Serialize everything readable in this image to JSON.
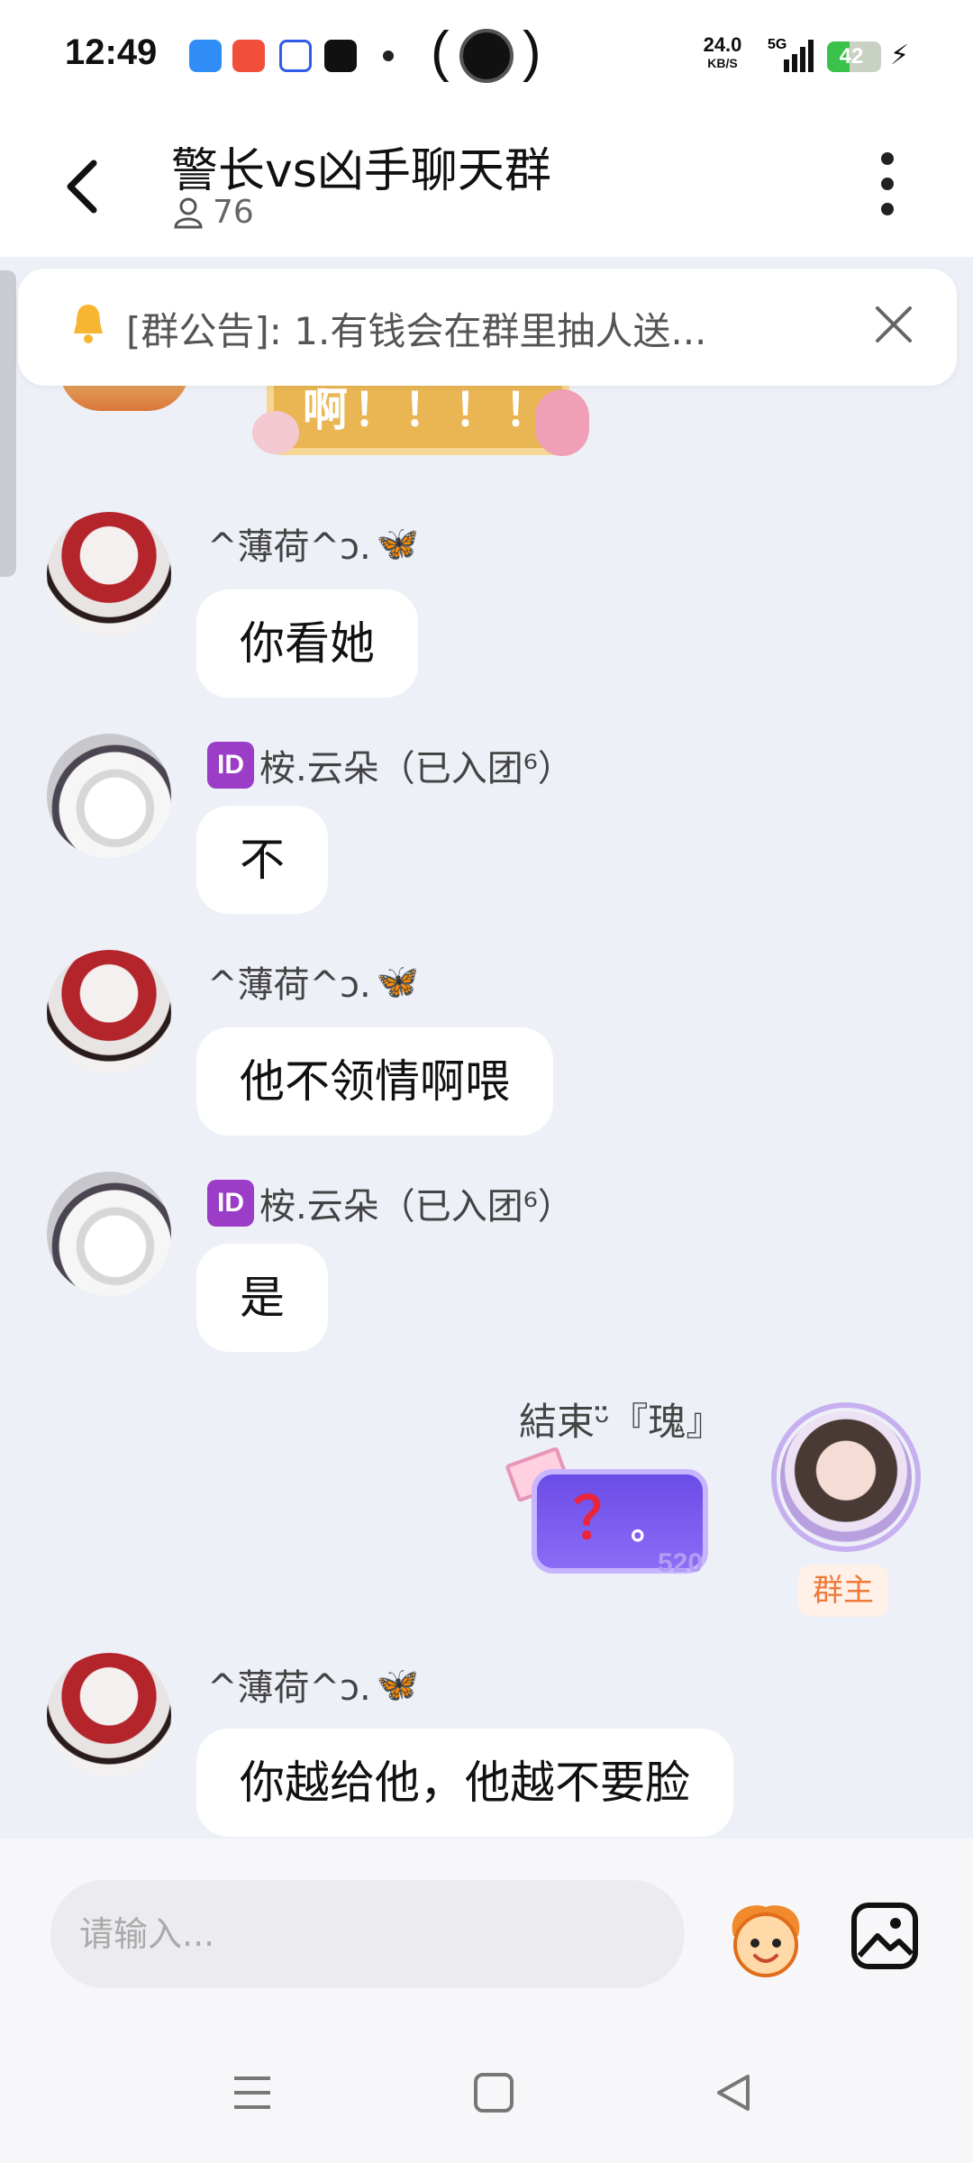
{
  "status_bar": {
    "time": "12:49",
    "net_speed_value": "24.0",
    "net_speed_unit": "KB/S",
    "network_type": "5G",
    "battery_level": "42",
    "battery_fraction": 0.42
  },
  "header": {
    "title": "警长vs凶手聊天群",
    "member_count": "76"
  },
  "announcement": {
    "text": "[群公告]: 1.有钱会在群里抽人送..."
  },
  "partial_sticker": {
    "text": "啊！！！！"
  },
  "messages": [
    {
      "sender": "^薄荷^ↄ.",
      "text": "你看她"
    },
    {
      "sender": "桉.云朵（已入团⁶）",
      "badge": "ID",
      "text": "不"
    },
    {
      "sender": "^薄荷^ↄ.",
      "text": "他不领情啊喂"
    },
    {
      "sender": "桉.云朵（已入团⁶）",
      "badge": "ID",
      "text": "是"
    },
    {
      "sender": "^薄荷^ↄ.",
      "text": "你越给他，他越不要脸"
    }
  ],
  "self_message": {
    "sender": "結束ᵕ̈『瑰』",
    "sticker_text": "？",
    "sticker_suffix": "。",
    "sticker_mark": "520",
    "role_tag": "群主"
  },
  "input": {
    "placeholder": "请输入..."
  },
  "colors": {
    "chat_background": "#eef0f8",
    "accent_owner": "#ee7a3a",
    "badge_purple": "#9b3dc7"
  }
}
